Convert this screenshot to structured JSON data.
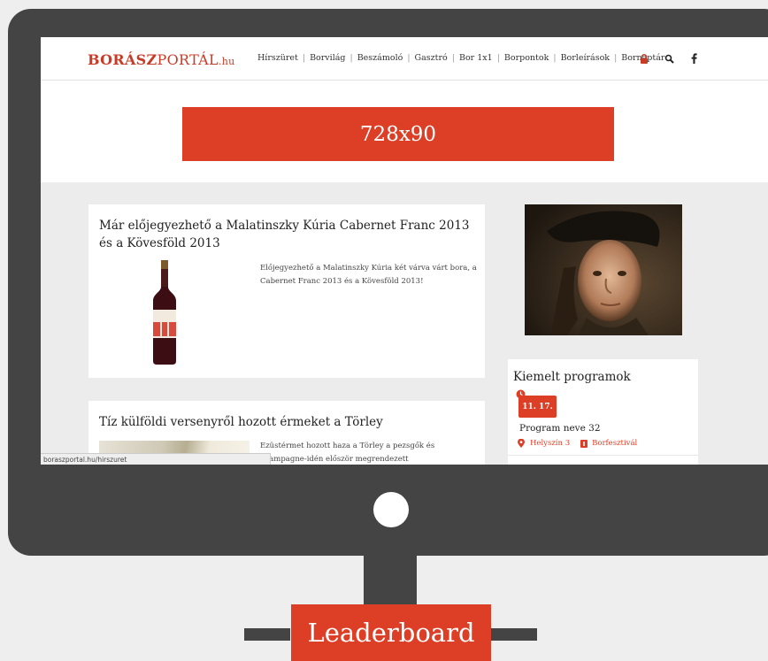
{
  "site": {
    "logo": {
      "part1": "BORÁSZ",
      "part2": "PORTÁL",
      "part3": ".hu"
    },
    "nav": [
      "Hírszüret",
      "Borvilág",
      "Beszámoló",
      "Gasztró",
      "Bor 1x1",
      "Borpontok",
      "Borleírások",
      "Bornaptár"
    ],
    "icons": [
      "lock-icon",
      "search-icon",
      "facebook-icon"
    ],
    "banner_label": "728x90"
  },
  "articles": [
    {
      "title": "Már előjegyezhető a Malatinszky Kúria Cabernet Franc 2013 és a Kövesföld 2013",
      "excerpt": "Előjegyezhető a Malatinszky Kúria két várva várt bora, a Cabernet Franc 2013 és a Kövesföld 2013!"
    },
    {
      "title": "Tíz külföldi versenyről hozott érmeket a Törley",
      "excerpt": "Ezüstérmet hozott haza a Törley a pezsgők és champagne-idén először megrendezett világbajnokságáról, aranyat"
    }
  ],
  "sidebar": {
    "widget_title": "Kiemelt programok",
    "program": {
      "date": "11. 17.",
      "name": "Program neve 32",
      "location": "Helyszín 3",
      "category": "Borfesztivál"
    }
  },
  "status_url": "boraszportal.hu/hirszuret",
  "leaderboard_label": "Leaderboard",
  "colors": {
    "accent": "#dd3e26",
    "monitor": "#444444",
    "background": "#eeeeee"
  }
}
